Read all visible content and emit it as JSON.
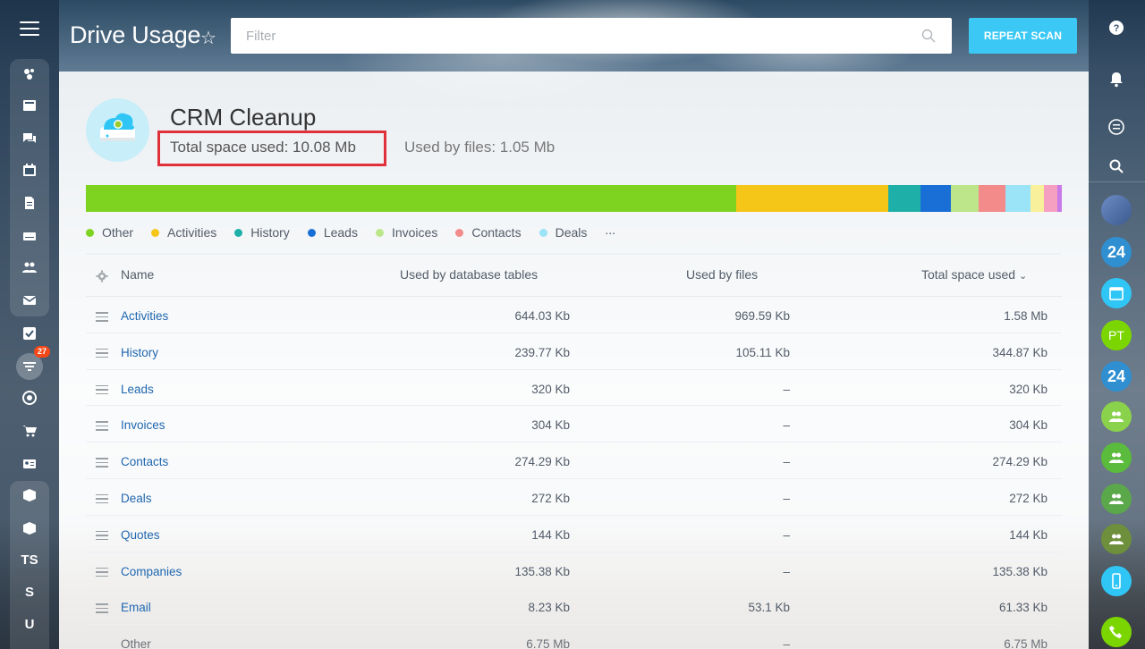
{
  "header": {
    "title": "Drive Usage",
    "filter_placeholder": "Filter",
    "repeat_scan_label": "REPEAT SCAN"
  },
  "sidebar": {
    "badge_count": "27",
    "text_items": [
      "TS",
      "S",
      "U"
    ]
  },
  "summary": {
    "name": "CRM Cleanup",
    "total_space": "Total space used: 10.08 Mb",
    "used_by_files": "Used by files: 1.05 Mb"
  },
  "usage_bar": [
    {
      "label": "Other",
      "color": "#7ed321",
      "fraction": 0.667
    },
    {
      "label": "Activities",
      "color": "#f5c518",
      "fraction": 0.156
    },
    {
      "label": "History",
      "color": "#1eb0a8",
      "fraction": 0.033
    },
    {
      "label": "Leads",
      "color": "#1a6fd6",
      "fraction": 0.031
    },
    {
      "label": "Invoices",
      "color": "#bde68a",
      "fraction": 0.029
    },
    {
      "label": "Contacts",
      "color": "#f48b8b",
      "fraction": 0.027
    },
    {
      "label": "Deals",
      "color": "#9be3f7",
      "fraction": 0.026
    },
    {
      "label": "",
      "color": "#f8f09a",
      "fraction": 0.014
    },
    {
      "label": "",
      "color": "#f5a0c0",
      "fraction": 0.013
    },
    {
      "label": "",
      "color": "#c77ae8",
      "fraction": 0.005
    }
  ],
  "legend": {
    "items": [
      {
        "label": "Other",
        "color": "#7ed321"
      },
      {
        "label": "Activities",
        "color": "#f5c518"
      },
      {
        "label": "History",
        "color": "#1eb0a8"
      },
      {
        "label": "Leads",
        "color": "#1a6fd6"
      },
      {
        "label": "Invoices",
        "color": "#bde68a"
      },
      {
        "label": "Contacts",
        "color": "#f48b8b"
      },
      {
        "label": "Deals",
        "color": "#9be3f7"
      }
    ],
    "more": "..."
  },
  "table": {
    "columns": [
      "Name",
      "Used by database tables",
      "Used by files",
      "Total space used"
    ],
    "rows": [
      {
        "name": "Activities",
        "db": "644.03 Kb",
        "files": "969.59 Kb",
        "total": "1.58 Mb"
      },
      {
        "name": "History",
        "db": "239.77 Kb",
        "files": "105.11 Kb",
        "total": "344.87 Kb"
      },
      {
        "name": "Leads",
        "db": "320 Kb",
        "files": "–",
        "total": "320 Kb"
      },
      {
        "name": "Invoices",
        "db": "304 Kb",
        "files": "–",
        "total": "304 Kb"
      },
      {
        "name": "Contacts",
        "db": "274.29 Kb",
        "files": "–",
        "total": "274.29 Kb"
      },
      {
        "name": "Deals",
        "db": "272 Kb",
        "files": "–",
        "total": "272 Kb"
      },
      {
        "name": "Quotes",
        "db": "144 Kb",
        "files": "–",
        "total": "144 Kb"
      },
      {
        "name": "Companies",
        "db": "135.38 Kb",
        "files": "–",
        "total": "135.38 Kb"
      },
      {
        "name": "Email",
        "db": "8.23 Kb",
        "files": "53.1 Kb",
        "total": "61.33 Kb"
      },
      {
        "name": "Other",
        "db": "6.75 Mb",
        "files": "–",
        "total": "6.75 Mb"
      }
    ]
  },
  "rightbar": {
    "badge_24": "24",
    "initials": "PT"
  }
}
